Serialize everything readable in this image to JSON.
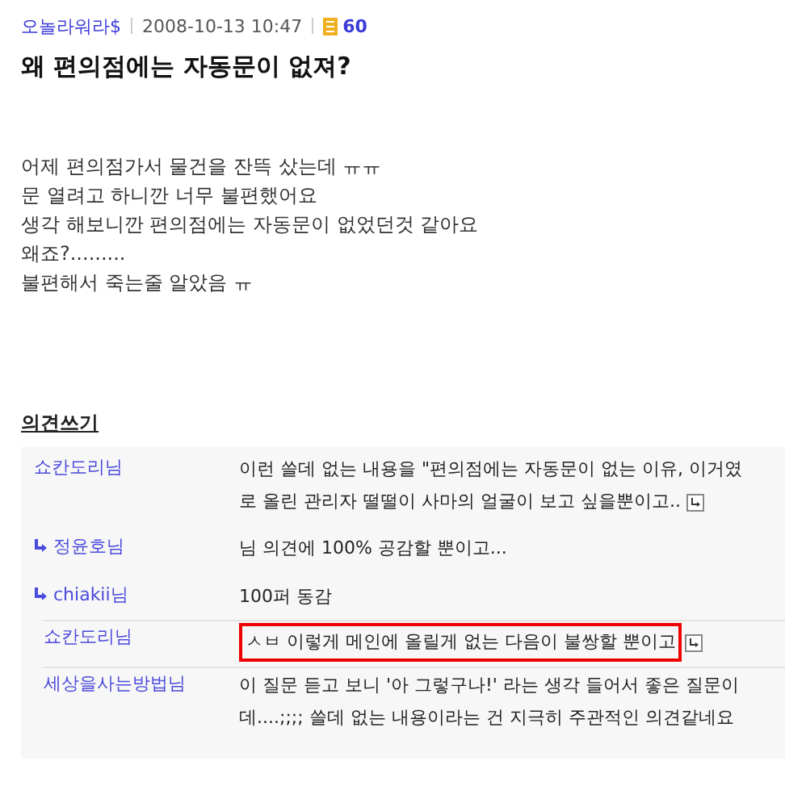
{
  "post": {
    "author": "오놀라워라$",
    "date": "2008-10-13 10:47",
    "views": "60",
    "title": "왜 편의점에는 자동문이 없져?",
    "body": [
      "어제 편의점가서 물건을 잔뜩 샀는데 ㅠㅠ",
      "문 열려고 하니깐 너무 불편했어요",
      "생각 해보니깐 편의점에는 자동문이 없었던것 같아요",
      "왜죠?.........",
      "불편해서 죽는줄 알았음 ㅠ"
    ]
  },
  "comments_heading": "의견쓰기",
  "comments": [
    {
      "kind": "comment",
      "author": "쇼칸도리님",
      "lines": [
        "이런 쓸데 없는 내용을 \"편의점에는 자동문이 없는 이유, 이거였",
        "로 올린 관리자 떨떨이 사마의 얼굴이 보고 싶을뿐이고.."
      ],
      "has_more": true,
      "highlighted": false
    },
    {
      "kind": "reply",
      "author": "정윤호님",
      "lines": [
        "님 의견에 100% 공감할 뿐이고..."
      ],
      "has_more": false,
      "highlighted": false
    },
    {
      "kind": "reply",
      "author": "chiakii님",
      "lines": [
        "100퍼 동감"
      ],
      "has_more": false,
      "highlighted": false
    },
    {
      "kind": "comment",
      "author": "쇼칸도리님",
      "lines": [
        "ㅅㅂ 이렇게 메인에 올릴게 없는 다음이 불쌍할 뿐이고"
      ],
      "has_more": true,
      "highlighted": true
    },
    {
      "kind": "comment",
      "author": "세상을사는방법님",
      "lines": [
        "이 질문 듣고 보니 '아 그렇구나!' 라는 생각 들어서 좋은 질문이",
        "데....;;;; 쓸데 없는 내용이라는 건 지극히 주관적인 의견같네요"
      ],
      "has_more": false,
      "highlighted": false
    }
  ]
}
